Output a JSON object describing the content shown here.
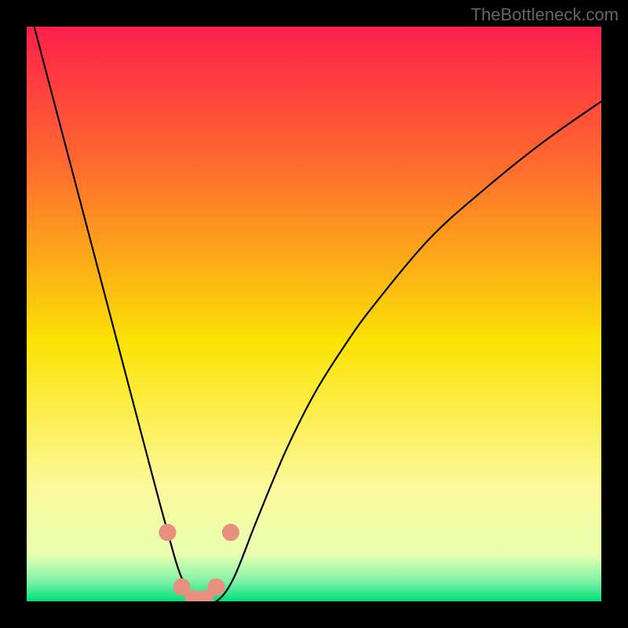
{
  "watermark": "TheBottleneck.com",
  "chart_data": {
    "type": "line",
    "title": "",
    "xlabel": "",
    "ylabel": "",
    "xlim": [
      0,
      100
    ],
    "ylim": [
      0,
      100
    ],
    "series": [
      {
        "name": "bottleneck-curve",
        "x": [
          0,
          5,
          10,
          15,
          20,
          24,
          27,
          30,
          33,
          36,
          40,
          45,
          50,
          55,
          60,
          70,
          80,
          90,
          100
        ],
        "y": [
          105,
          86,
          67,
          48,
          29,
          14,
          4,
          0,
          0,
          4,
          14,
          26,
          36,
          44,
          51,
          63,
          72,
          80,
          87
        ]
      }
    ],
    "markers": {
      "name": "highlight-dots",
      "color": "#e8907f",
      "x": [
        24.5,
        27,
        29,
        31,
        33,
        35.5
      ],
      "y": [
        12,
        2.5,
        0.5,
        0.5,
        2.5,
        12
      ]
    },
    "background_gradient": {
      "stops": [
        {
          "offset": 0.0,
          "color": "#ff1f4b"
        },
        {
          "offset": 0.25,
          "color": "#ff6e2d"
        },
        {
          "offset": 0.55,
          "color": "#fbe304"
        },
        {
          "offset": 0.8,
          "color": "#fcf99a"
        },
        {
          "offset": 0.92,
          "color": "#e6ffb0"
        },
        {
          "offset": 0.965,
          "color": "#7ef2a6"
        },
        {
          "offset": 1.0,
          "color": "#00e07a"
        }
      ]
    }
  }
}
